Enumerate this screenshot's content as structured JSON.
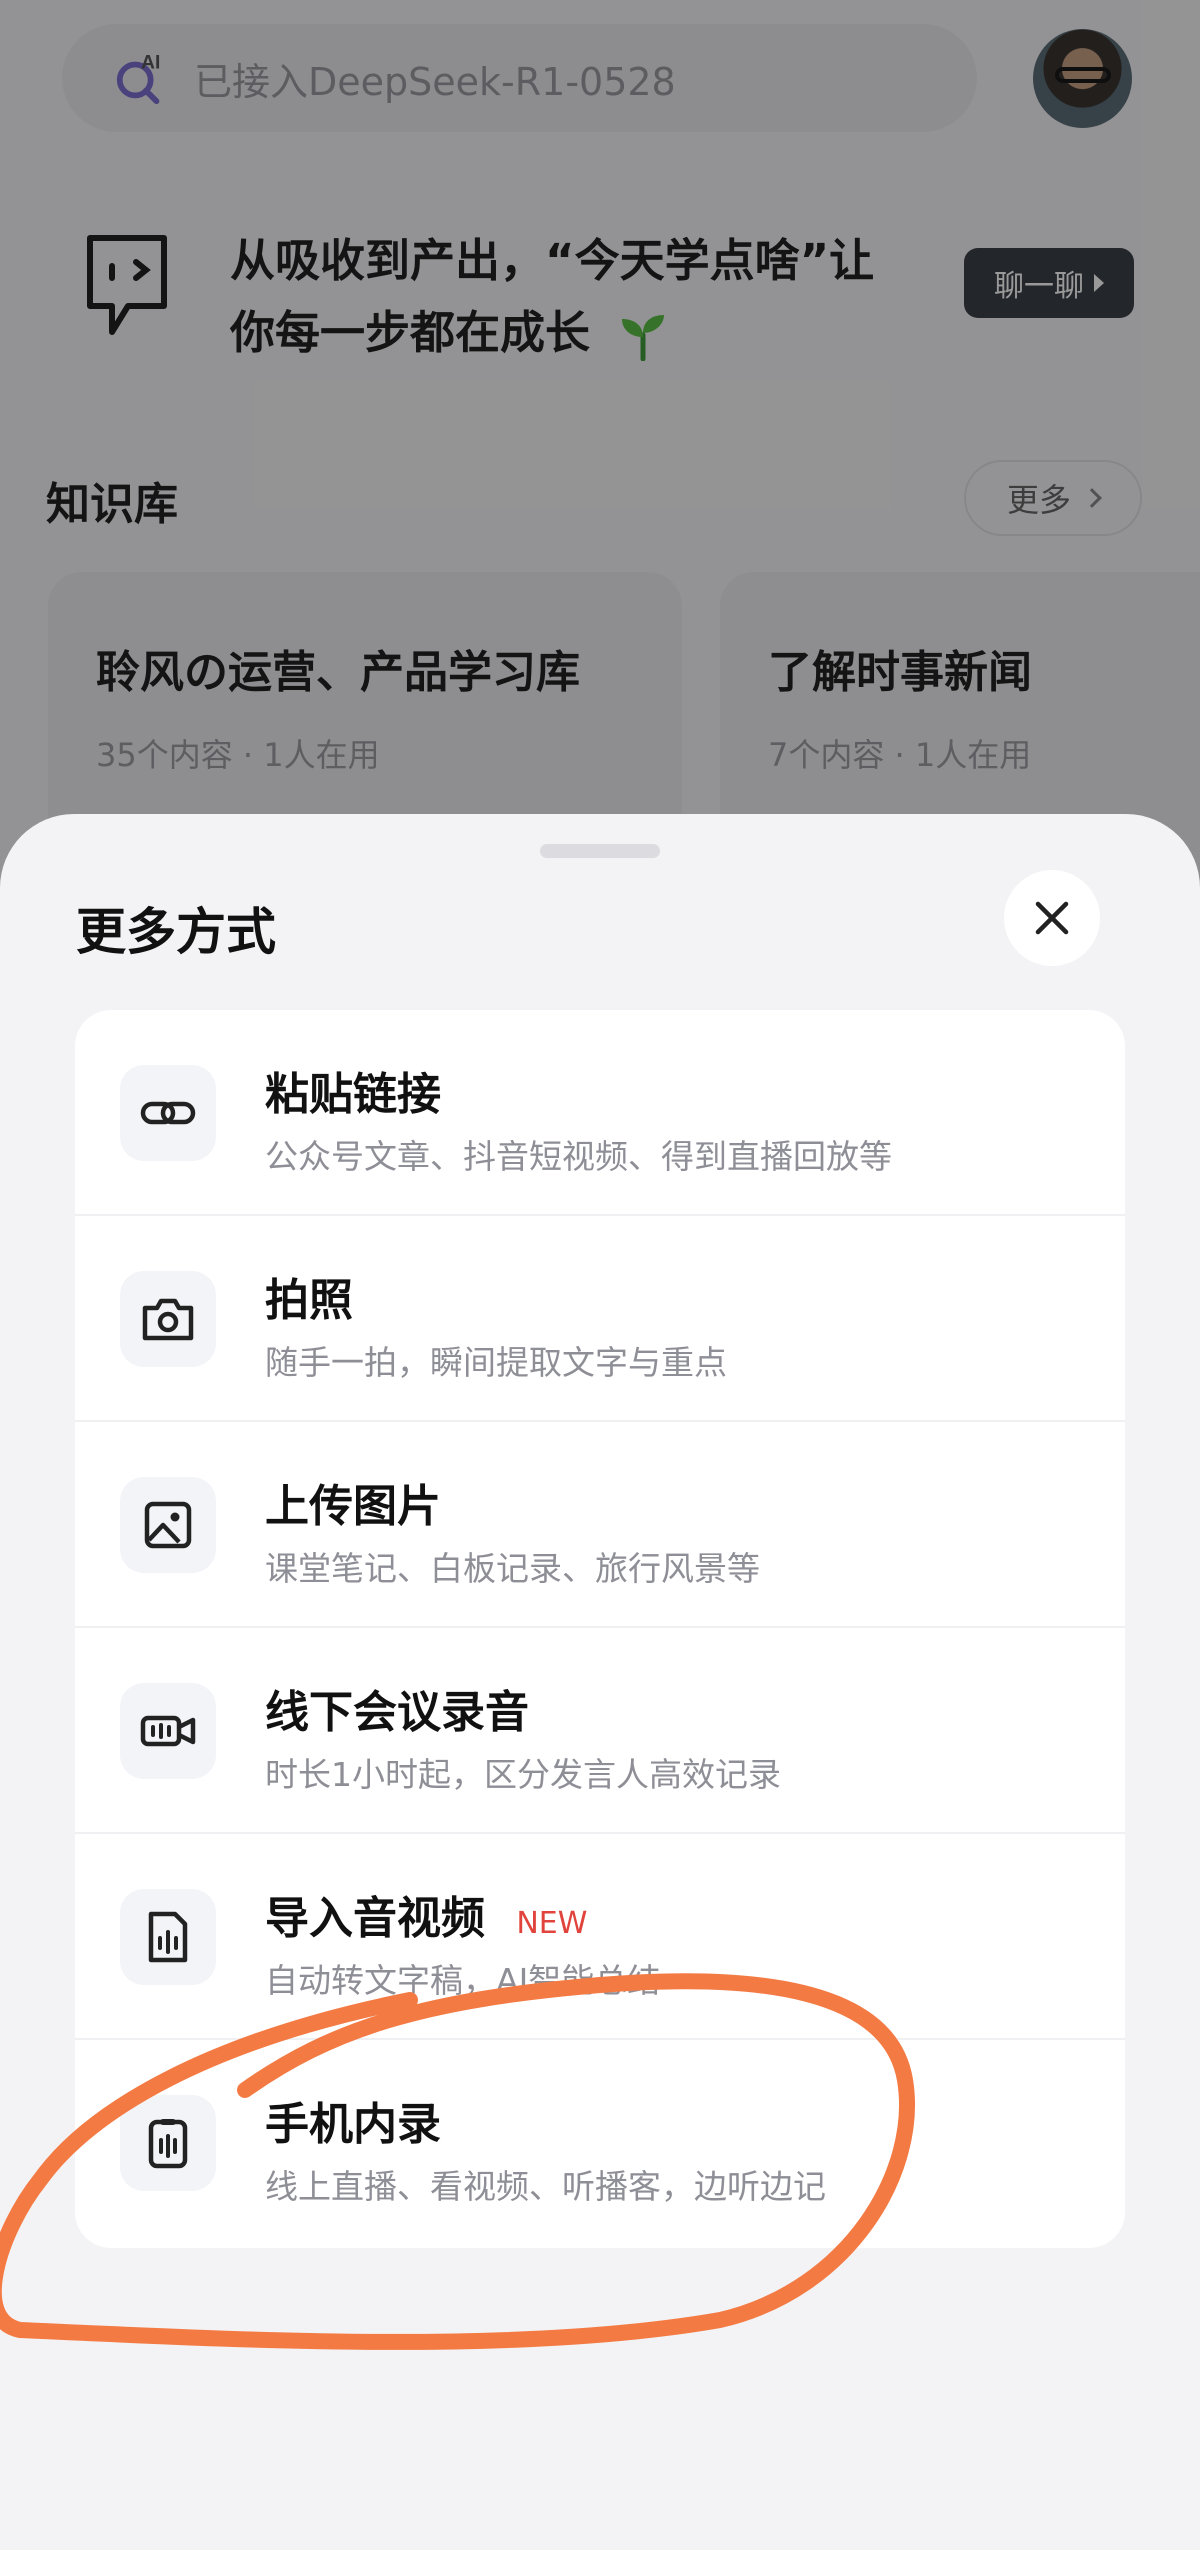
{
  "search": {
    "placeholder": "已接入DeepSeek-R1-0528",
    "icon": "ai-search-icon"
  },
  "banner": {
    "line1": "从吸收到产出，“今天学点啥”让",
    "line2": "你每一步都在成长",
    "chat_button": "聊一聊"
  },
  "knowledge_base": {
    "title": "知识库",
    "more": "更多",
    "cards": [
      {
        "title": "聆风の运营、产品学习库",
        "meta": "35个内容 · 1人在用"
      },
      {
        "title": "了解时事新闻",
        "meta": "7个内容 · 1人在用"
      }
    ]
  },
  "sheet": {
    "title": "更多方式",
    "options": [
      {
        "title": "粘贴链接",
        "subtitle": "公众号文章、抖音短视频、得到直播回放等",
        "icon": "link-icon"
      },
      {
        "title": "拍照",
        "subtitle": "随手一拍，瞬间提取文字与重点",
        "icon": "camera-icon"
      },
      {
        "title": "上传图片",
        "subtitle": "课堂笔记、白板记录、旅行风景等",
        "icon": "image-icon"
      },
      {
        "title": "线下会议录音",
        "subtitle": "时长1小时起，区分发言人高效记录",
        "icon": "video-record-icon"
      },
      {
        "title": "导入音视频",
        "badge": "NEW",
        "subtitle": "自动转文字稿，AI智能总结",
        "icon": "audio-file-icon"
      },
      {
        "title": "手机内录",
        "subtitle": "线上直播、看视频、听播客，边听边记",
        "icon": "phone-record-icon"
      }
    ]
  },
  "colors": {
    "annotation": "#f47a43",
    "badge": "#e0443c",
    "chat_button_bg": "#3b4048"
  }
}
